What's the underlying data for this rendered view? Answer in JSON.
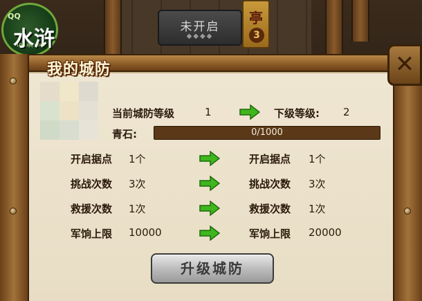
{
  "scene": {
    "locked_label": "未开启",
    "pavilion_sign": "亭",
    "pavilion_number": "3"
  },
  "logo": {
    "brand": "QQ",
    "title": "水浒",
    "url": "108.qq.com"
  },
  "panel": {
    "title": "我的城防",
    "close_icon": "close-x",
    "current_level_label": "当前城防等级",
    "current_level_value": "1",
    "next_level_label": "下级等级:",
    "next_level_value": "2",
    "resource_label": "青石:",
    "resource_progress": {
      "current": 0,
      "max": 1000,
      "text": "0/1000"
    },
    "rows": [
      {
        "label": "开启据点",
        "current": "1个",
        "next_label": "开启据点",
        "next": "1个"
      },
      {
        "label": "挑战次数",
        "current": "3次",
        "next_label": "挑战次数",
        "next": "3次"
      },
      {
        "label": "救援次数",
        "current": "1次",
        "next_label": "救援次数",
        "next": "1次"
      },
      {
        "label": "军饷上限",
        "current": "10000",
        "next_label": "军饷上限",
        "next": "20000"
      }
    ],
    "upgrade_button": "升级城防"
  },
  "colors": {
    "arrow_green": "#3fb61e",
    "parchment": "#efe6d2",
    "wood": "#8a5a26"
  }
}
